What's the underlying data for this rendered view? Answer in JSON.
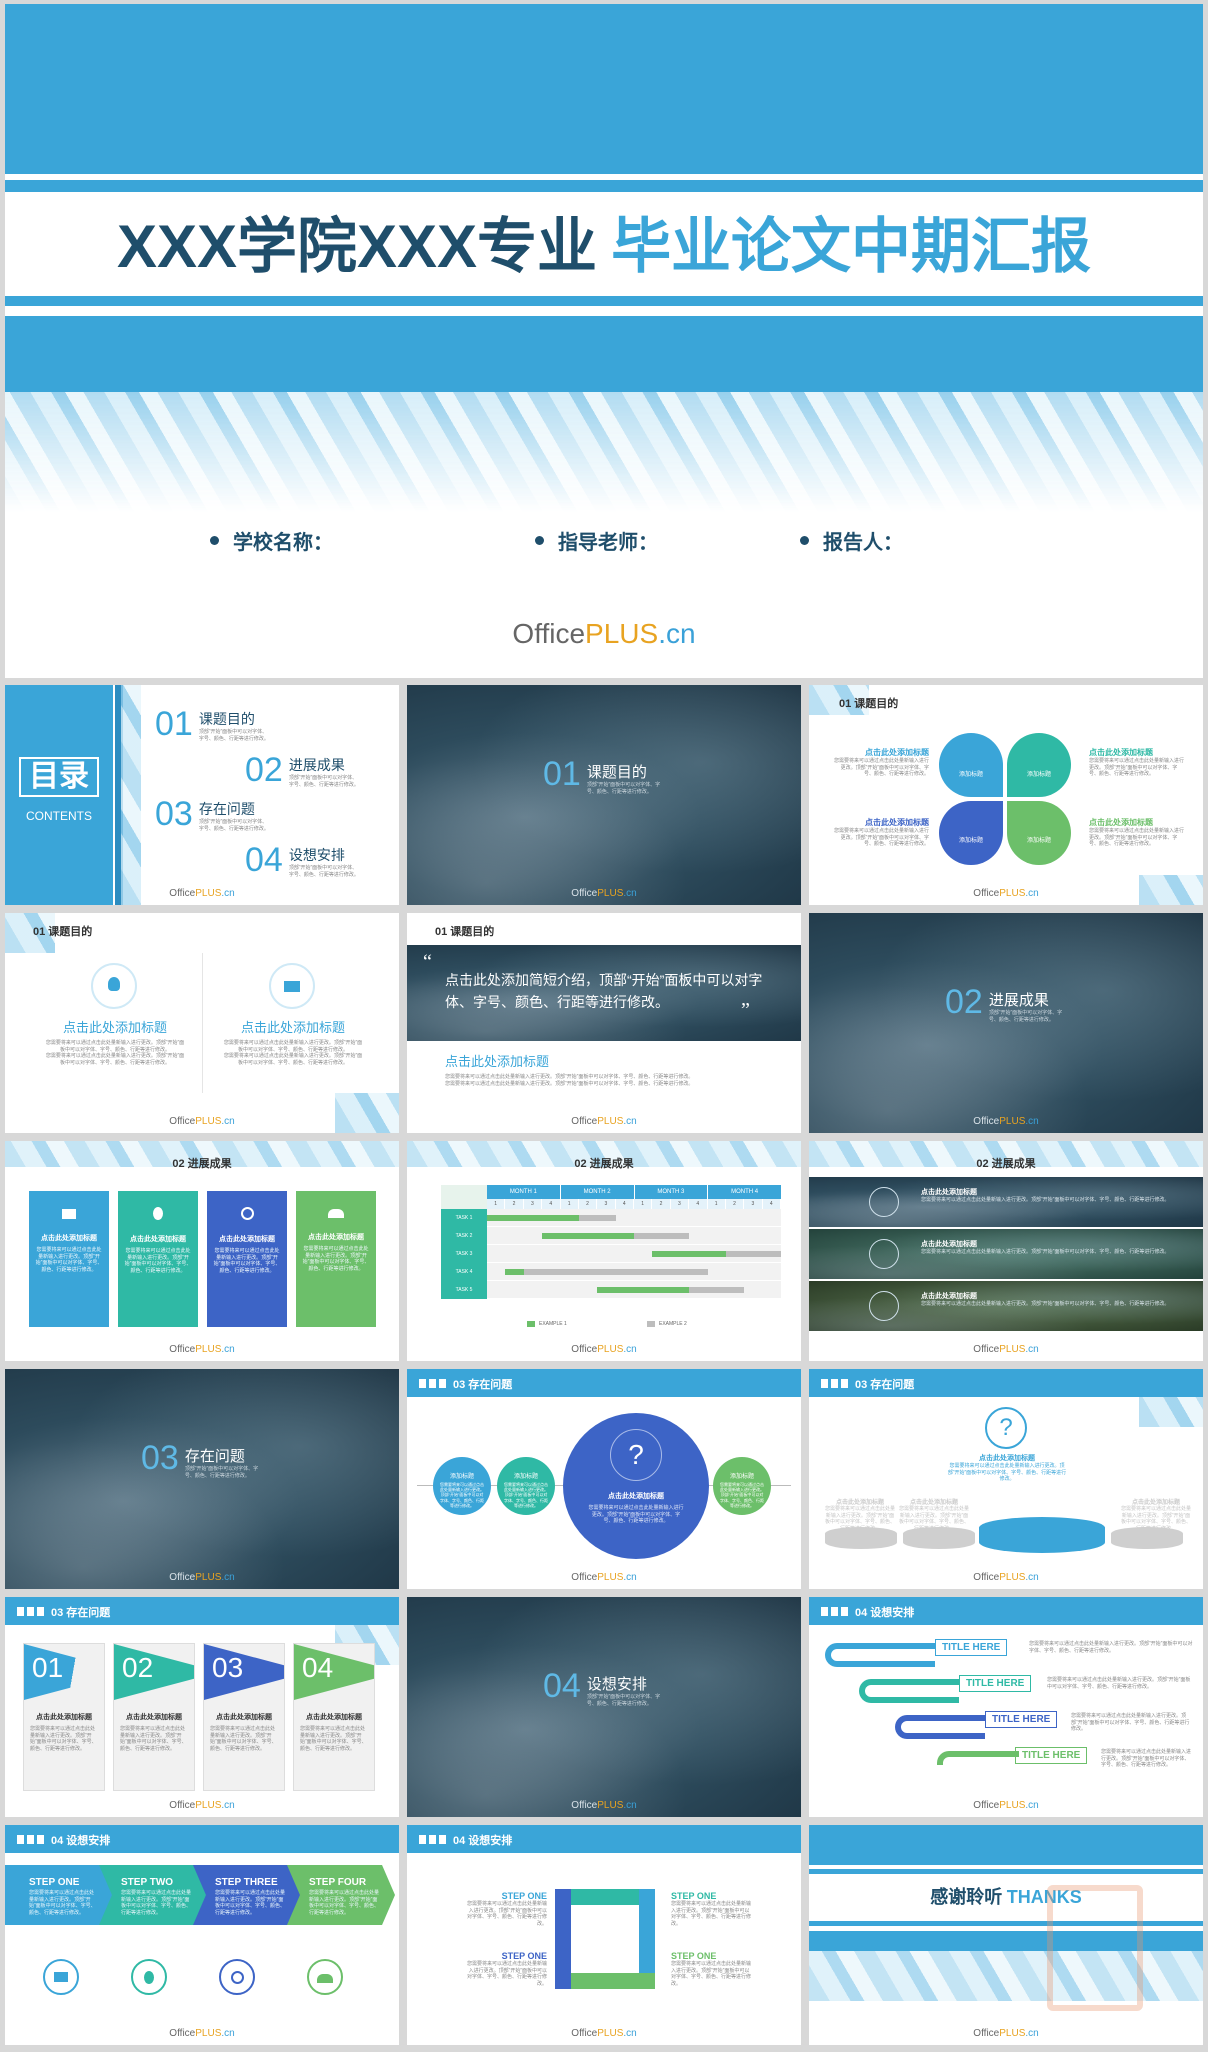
{
  "cover": {
    "title_part1": "XXX学院XXX专业",
    "title_part2": "毕业论文中期汇报",
    "fields": [
      "学校名称：",
      "指导老师：",
      "报告人："
    ],
    "logo": {
      "office": "Office",
      "plus": "PLUS",
      "cn": ".cn"
    }
  },
  "toc": {
    "title": "目录",
    "subtitle": "CONTENTS",
    "items": [
      {
        "num": "01",
        "label": "课题目的"
      },
      {
        "num": "02",
        "label": "进展成果"
      },
      {
        "num": "03",
        "label": "存在问题"
      },
      {
        "num": "04",
        "label": "设想安排"
      }
    ],
    "desc": "顶部“开始”面板中可以对字体、字号、颜色、行距等进行修改。"
  },
  "sections": [
    {
      "num": "01",
      "label": "课题目的"
    },
    {
      "num": "02",
      "label": "进展成果"
    },
    {
      "num": "03",
      "label": "存在问题"
    },
    {
      "num": "04",
      "label": "设想安排"
    }
  ],
  "headers": {
    "s1": "01 课题目的",
    "s2": "02 进展成果",
    "s3": "03 存在问题",
    "s4": "04 设想安排"
  },
  "common": {
    "click_title": "点击此处添加标题",
    "add_title": "添加标题",
    "body_text": "您需要将来可以通过点击此处量新输入进行更改。顶部“开始”面板中可以对字体、字号、颜色、行距等进行修改。",
    "quote": "点击此处添加简短介绍，顶部“开始”面板中可以对字体、字号、颜色、行距等进行修改。",
    "question": "?",
    "title_here": "TITLE HERE"
  },
  "gantt": {
    "months": [
      "MONTH 1",
      "MONTH 2",
      "MONTH 3",
      "MONTH 4"
    ],
    "weeks": [
      "1",
      "2",
      "3",
      "4"
    ],
    "tasks": [
      "TASK 1",
      "TASK 2",
      "TASK 3",
      "TASK 4",
      "TASK 5"
    ],
    "legend": [
      "EXAMPLE 1",
      "EXAMPLE 2"
    ]
  },
  "problem_nums": [
    "01",
    "02",
    "03",
    "04"
  ],
  "steps": [
    "STEP ONE",
    "STEP TWO",
    "STEP THREE",
    "STEP FOUR"
  ],
  "cycle_steps": [
    "STEP ONE",
    "STEP ONE",
    "STEP ONE",
    "STEP ONE"
  ],
  "thanks": {
    "cn": "感谢聆听",
    "en": "THANKS"
  },
  "colors": {
    "blue": "#3aa5d8",
    "teal": "#2fb9a5",
    "royal": "#3d64c6",
    "green": "#6cbf6a",
    "navy": "#1f4e6b"
  }
}
